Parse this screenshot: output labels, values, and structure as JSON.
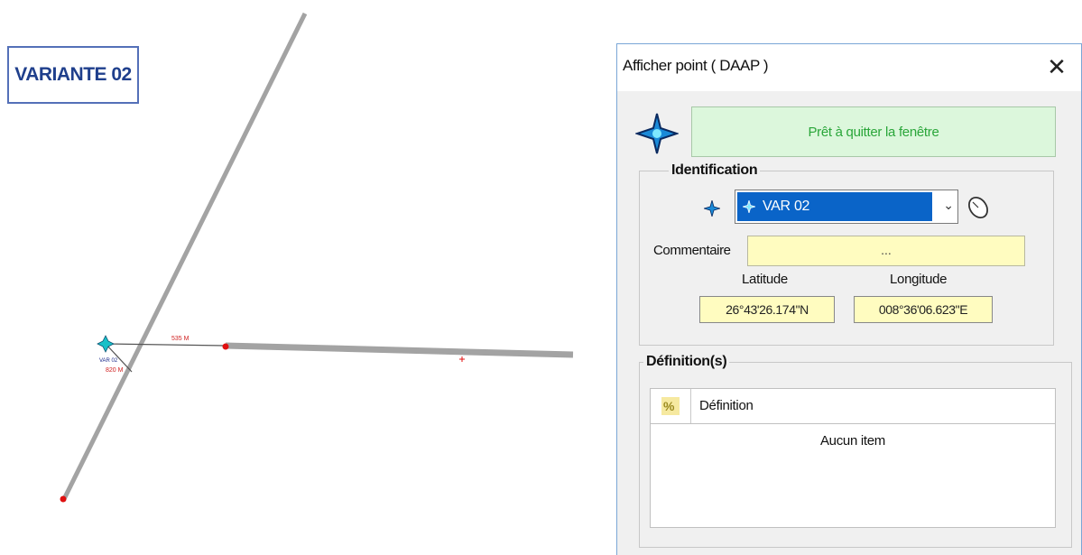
{
  "variant_label": "VARIANTE 02",
  "map": {
    "point_name": "VAR 02",
    "distance_1": "535 M",
    "distance_2": "820 M",
    "colors": {
      "road": "#a3a3a3",
      "endpoint": "#e01010",
      "point": "#00aaaa",
      "measure": "#d02020"
    }
  },
  "dialog": {
    "title": "Afficher point ( DAAP )",
    "close_glyph": "✕",
    "status": "Prêt à quitter la fenêtre",
    "identification": {
      "legend": "Identification",
      "selected_point": "VAR 02",
      "comment_label": "Commentaire",
      "comment_value": "...",
      "latitude_label": "Latitude",
      "latitude_value": "26°43'26.174\"N",
      "longitude_label": "Longitude",
      "longitude_value": "008°36'06.623\"E"
    },
    "definitions": {
      "legend": "Définition(s)",
      "column_header": "Définition",
      "empty_text": "Aucun item"
    },
    "colors": {
      "status_bg": "#dcf7dc",
      "status_text": "#2aa63a",
      "field_bg": "#fffcc0",
      "selection": "#0a64c8"
    }
  }
}
